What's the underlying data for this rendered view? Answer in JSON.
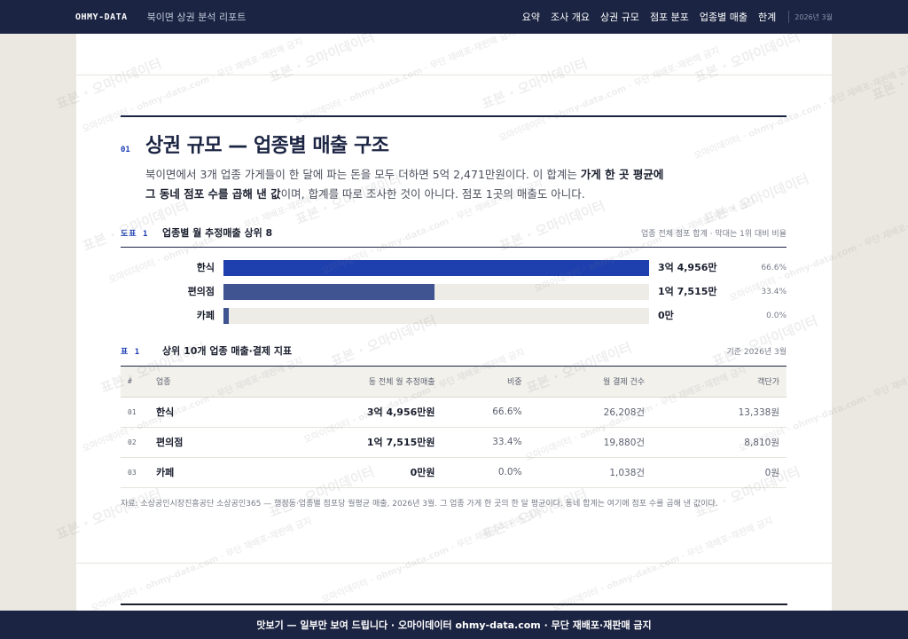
{
  "topbar": {
    "brand": "OHMY-DATA",
    "report_name": "북이면 상권 분석 리포트",
    "nav": [
      "요약",
      "조사 개요",
      "상권 규모",
      "점포 분포",
      "업종별 매출",
      "한계"
    ],
    "date": "2026년 3월"
  },
  "section": {
    "number": "01",
    "title": "상권 규모 — 업종별 매출 구조",
    "lede_1": "북이면에서 3개 업종 가게들이 한 달에 파는 돈을 모두 더하면 5억 2,471만원이다. 이 합계는 ",
    "lede_bold_1": "가게 한 곳 평균에",
    "lede_bold_2": "그 동네 점포 수를 곱해 낸 값",
    "lede_2": "이며, 합계를 따로 조사한 것이 아니다. 점포 1곳의 매출도 아니다."
  },
  "figure": {
    "number": "도표 1",
    "title": "업종별 월 추정매출 상위 8",
    "note": "업종 전체 점포 합계 · 막대는 1위 대비 비율"
  },
  "chart_data": {
    "type": "bar",
    "orientation": "horizontal",
    "categories": [
      "한식",
      "편의점",
      "카페"
    ],
    "values": [
      100,
      49.5,
      1.2
    ],
    "value_labels": [
      "3억 4,956만",
      "1억 7,515만",
      "0만"
    ],
    "share_labels": [
      "66.6%",
      "33.4%",
      "0.0%"
    ],
    "colors": [
      "#1e40af",
      "#3f5490",
      "#3f5490"
    ],
    "xlim": [
      0,
      100
    ]
  },
  "table": {
    "number": "표 1",
    "title": "상위 10개 업종 매출·결제 지표",
    "note": "기준 2026년 3월",
    "columns": [
      "#",
      "업종",
      "동 전체 월 추정매출",
      "비중",
      "월 결제 건수",
      "객단가"
    ],
    "rows": [
      {
        "rank": "01",
        "industry": "한식",
        "sales": "3억 4,956만원",
        "share": "66.6%",
        "count": "26,208건",
        "unit_price": "13,338원"
      },
      {
        "rank": "02",
        "industry": "편의점",
        "sales": "1억 7,515만원",
        "share": "33.4%",
        "count": "19,880건",
        "unit_price": "8,810원"
      },
      {
        "rank": "03",
        "industry": "카페",
        "sales": "0만원",
        "share": "0.0%",
        "count": "1,038건",
        "unit_price": "0원"
      }
    ]
  },
  "source": "자료: 소상공인시장진흥공단 소상공인365 — 행정동·업종별 점포당 월평균 매출, 2026년 3월. 그 업종 가게 한 곳의 한 달 평균이다. 동네 합계는 여기에 점포 수를 곱해 낸 값이다.",
  "watermark": {
    "big": "표본 · 오마이데이터",
    "small": "오마이데이터 · ohmy-data.com · 무단 재배포·재판매 금지"
  },
  "banner": "맛보기 — 일부만 보여 드립니다 · 오마이데이터 ohmy-data.com · 무단 재배포·재판매 금지"
}
